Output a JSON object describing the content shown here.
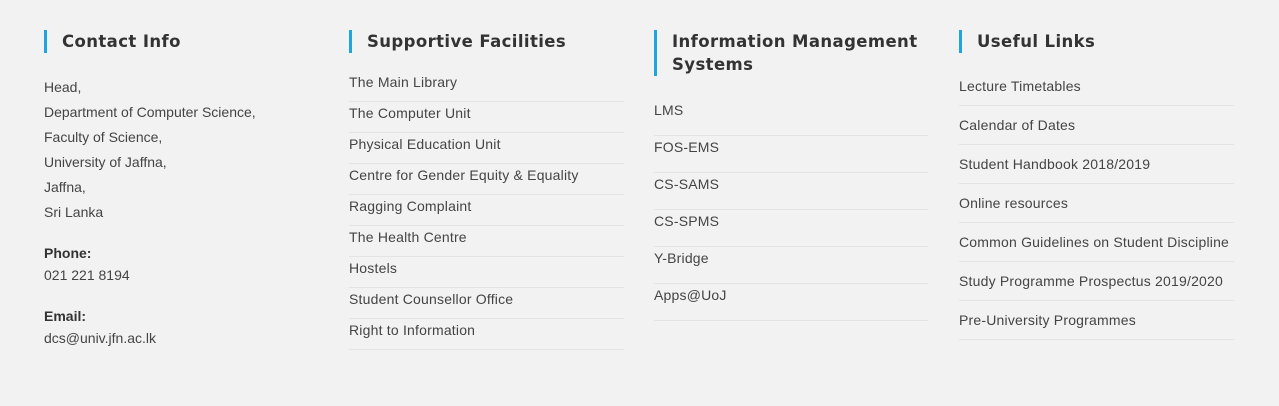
{
  "contact": {
    "title": "Contact Info",
    "address_lines": [
      "Head,",
      "Department of Computer Science,",
      "Faculty of Science,",
      "University of Jaffna,",
      "Jaffna,",
      "Sri Lanka"
    ],
    "phone_label": "Phone:",
    "phone": "021 221 8194",
    "email_label": "Email:",
    "email": "dcs@univ.jfn.ac.lk"
  },
  "facilities": {
    "title": "Supportive Facilities",
    "items": [
      "The Main Library",
      "The Computer Unit",
      "Physical Education Unit",
      "Centre for Gender Equity & Equality",
      "Ragging Complaint",
      "The Health Centre",
      "Hostels",
      "Student Counsellor Office",
      "Right to Information"
    ]
  },
  "ims": {
    "title": "Information Management Systems",
    "items": [
      "LMS",
      "FOS-EMS",
      "CS-SAMS",
      "CS-SPMS",
      "Y-Bridge",
      "Apps@UoJ"
    ]
  },
  "useful_links": {
    "title": "Useful Links",
    "items": [
      "Lecture Timetables",
      "Calendar of Dates",
      "Student Handbook 2018/2019",
      "Online resources",
      "Common Guidelines on Student Discipline",
      "Study Programme Prospectus 2019/2020",
      "Pre-University Programmes"
    ]
  },
  "colors": {
    "accent": "#1ea5df",
    "background": "#f2f2f2",
    "text": "#444444"
  }
}
